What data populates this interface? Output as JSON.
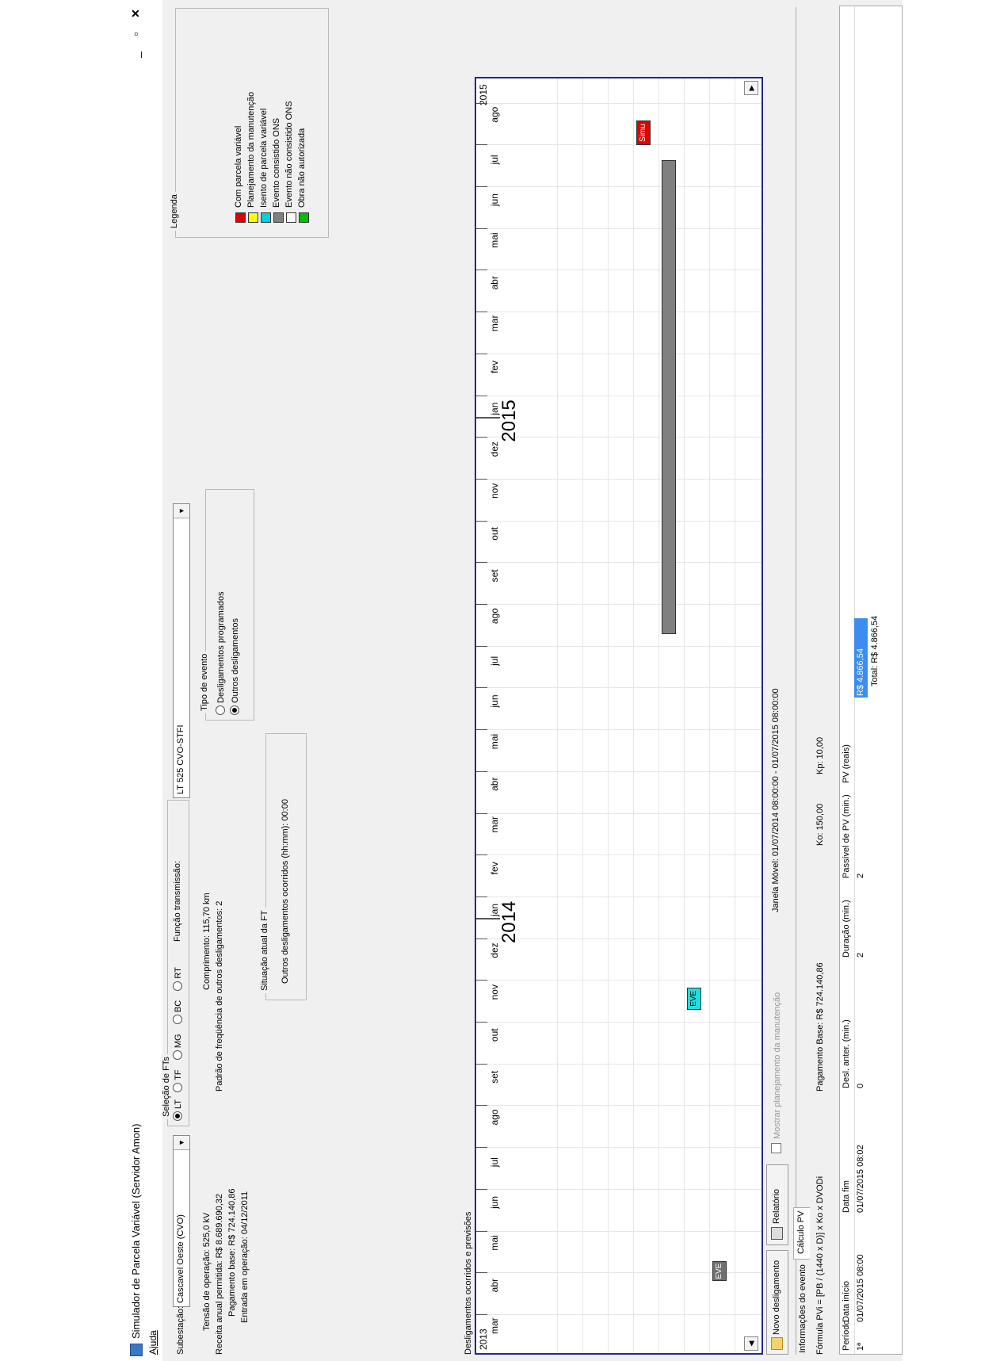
{
  "window": {
    "title": "Simulador de Parcela Variável (Servidor Amon)",
    "minimize": "_",
    "maximize": "▫",
    "close": "✕"
  },
  "menu": {
    "ajuda": "Ajuda"
  },
  "subestacao": {
    "label": "Subestação:",
    "value": "Cascavel Oeste (CVO)"
  },
  "selecao_fts": {
    "title": "Seleção de FTs",
    "options": [
      "LT",
      "TF",
      "MG",
      "BC",
      "RT"
    ],
    "selected": "LT",
    "funcao_label": "Função transmissão:",
    "funcao_value": "LT 525 CVO-STFI"
  },
  "info": {
    "tensao": "Tensão de operação: 525,0 kV",
    "comprimento": "Comprimento: 115,70 km",
    "receita": "Receita anual permitida: R$ 8.689.690,32",
    "padrao": "Padrão de freqüência de outros desligamentos: 2",
    "pagamento": "Pagamento base: R$ 724.140,86",
    "entrada": "Entrada em operação: 04/12/2011"
  },
  "tipo_evento": {
    "title": "Tipo de evento",
    "options": [
      "Desligamentos programados",
      "Outros desligamentos"
    ],
    "selected": "Outros desligamentos"
  },
  "situacao": {
    "title": "Situação atual da FT",
    "text": "Outros desligamentos ocorridos (hh:mm): 00:00"
  },
  "legenda": {
    "title": "Legenda",
    "items": [
      {
        "label": "Com parcela variável",
        "color": "#e00000"
      },
      {
        "label": "Planejamento da manutenção",
        "color": "#ffff00"
      },
      {
        "label": "Isento de parcela variável",
        "color": "#00d0e0"
      },
      {
        "label": "Evento consistido ONS",
        "color": "#808080"
      },
      {
        "label": "Evento não consistido ONS",
        "color": "#ffffff"
      },
      {
        "label": "Obra não autorizada",
        "color": "#00c000"
      }
    ]
  },
  "timeline": {
    "section_label": "Desligamentos ocorridos e previsões",
    "year_start": "2013",
    "year_end": "2015",
    "months": [
      "mar",
      "abr",
      "mai",
      "jun",
      "jul",
      "ago",
      "set",
      "out",
      "nov",
      "dez",
      "jan",
      "fev",
      "mar",
      "abr",
      "mai",
      "jun",
      "jul",
      "ago",
      "set",
      "out",
      "nov",
      "dez",
      "jan",
      "fev",
      "mar",
      "abr",
      "mai",
      "jun",
      "jul",
      "ago"
    ],
    "year_markers": [
      {
        "label": "2014",
        "month_index": 10
      },
      {
        "label": "2015",
        "month_index": 22
      }
    ],
    "events": [
      {
        "label": "EVE",
        "color": "#707070",
        "text_color": "#ffffff",
        "start": 1.3,
        "end": 1.75,
        "row": 7
      },
      {
        "label": "EVE",
        "color": "#22dddd",
        "text_color": "#000000",
        "start": 7.8,
        "end": 8.3,
        "row": 6
      },
      {
        "label": "",
        "color": "#808080",
        "text_color": "#000000",
        "start": 16.8,
        "end": 28.1,
        "row": 5
      },
      {
        "label": "Simu",
        "color": "#e00000",
        "text_color": "#ffffff",
        "start": 28.5,
        "end": 29.05,
        "row": 4
      }
    ],
    "scroll_left": "◀",
    "scroll_right": "▶"
  },
  "actions": {
    "novo": "Novo desligamento",
    "relatorio": "Relatório",
    "mostrar": "Mostrar planejamento da manutenção",
    "janela": "Janela Móvel: 01/07/2014 08:00:00 - 01/07/2015 08:00:00"
  },
  "tabs": [
    "Informações do evento",
    "Cálculo PV"
  ],
  "formula": {
    "text": "Fórmula PVi = [PB / (1440 x D)] x Ko x DVODi",
    "pagamento": "Pagamento Base: R$ 724.140,86",
    "ko": "Ko: 150,00",
    "kp": "Kp: 10,00"
  },
  "table": {
    "headers": [
      "Período",
      "Data início",
      "Data fim",
      "Desl. anter. (min.)",
      "Duração (min.)",
      "Passível de PV (min.)",
      "PV (reais)"
    ],
    "rows": [
      [
        "1ª",
        "01/07/2015 08:00",
        "01/07/2015 08:02",
        "0",
        "2",
        "2",
        "R$ 4.866,54"
      ]
    ],
    "total": "Total: R$ 4.866,54"
  }
}
